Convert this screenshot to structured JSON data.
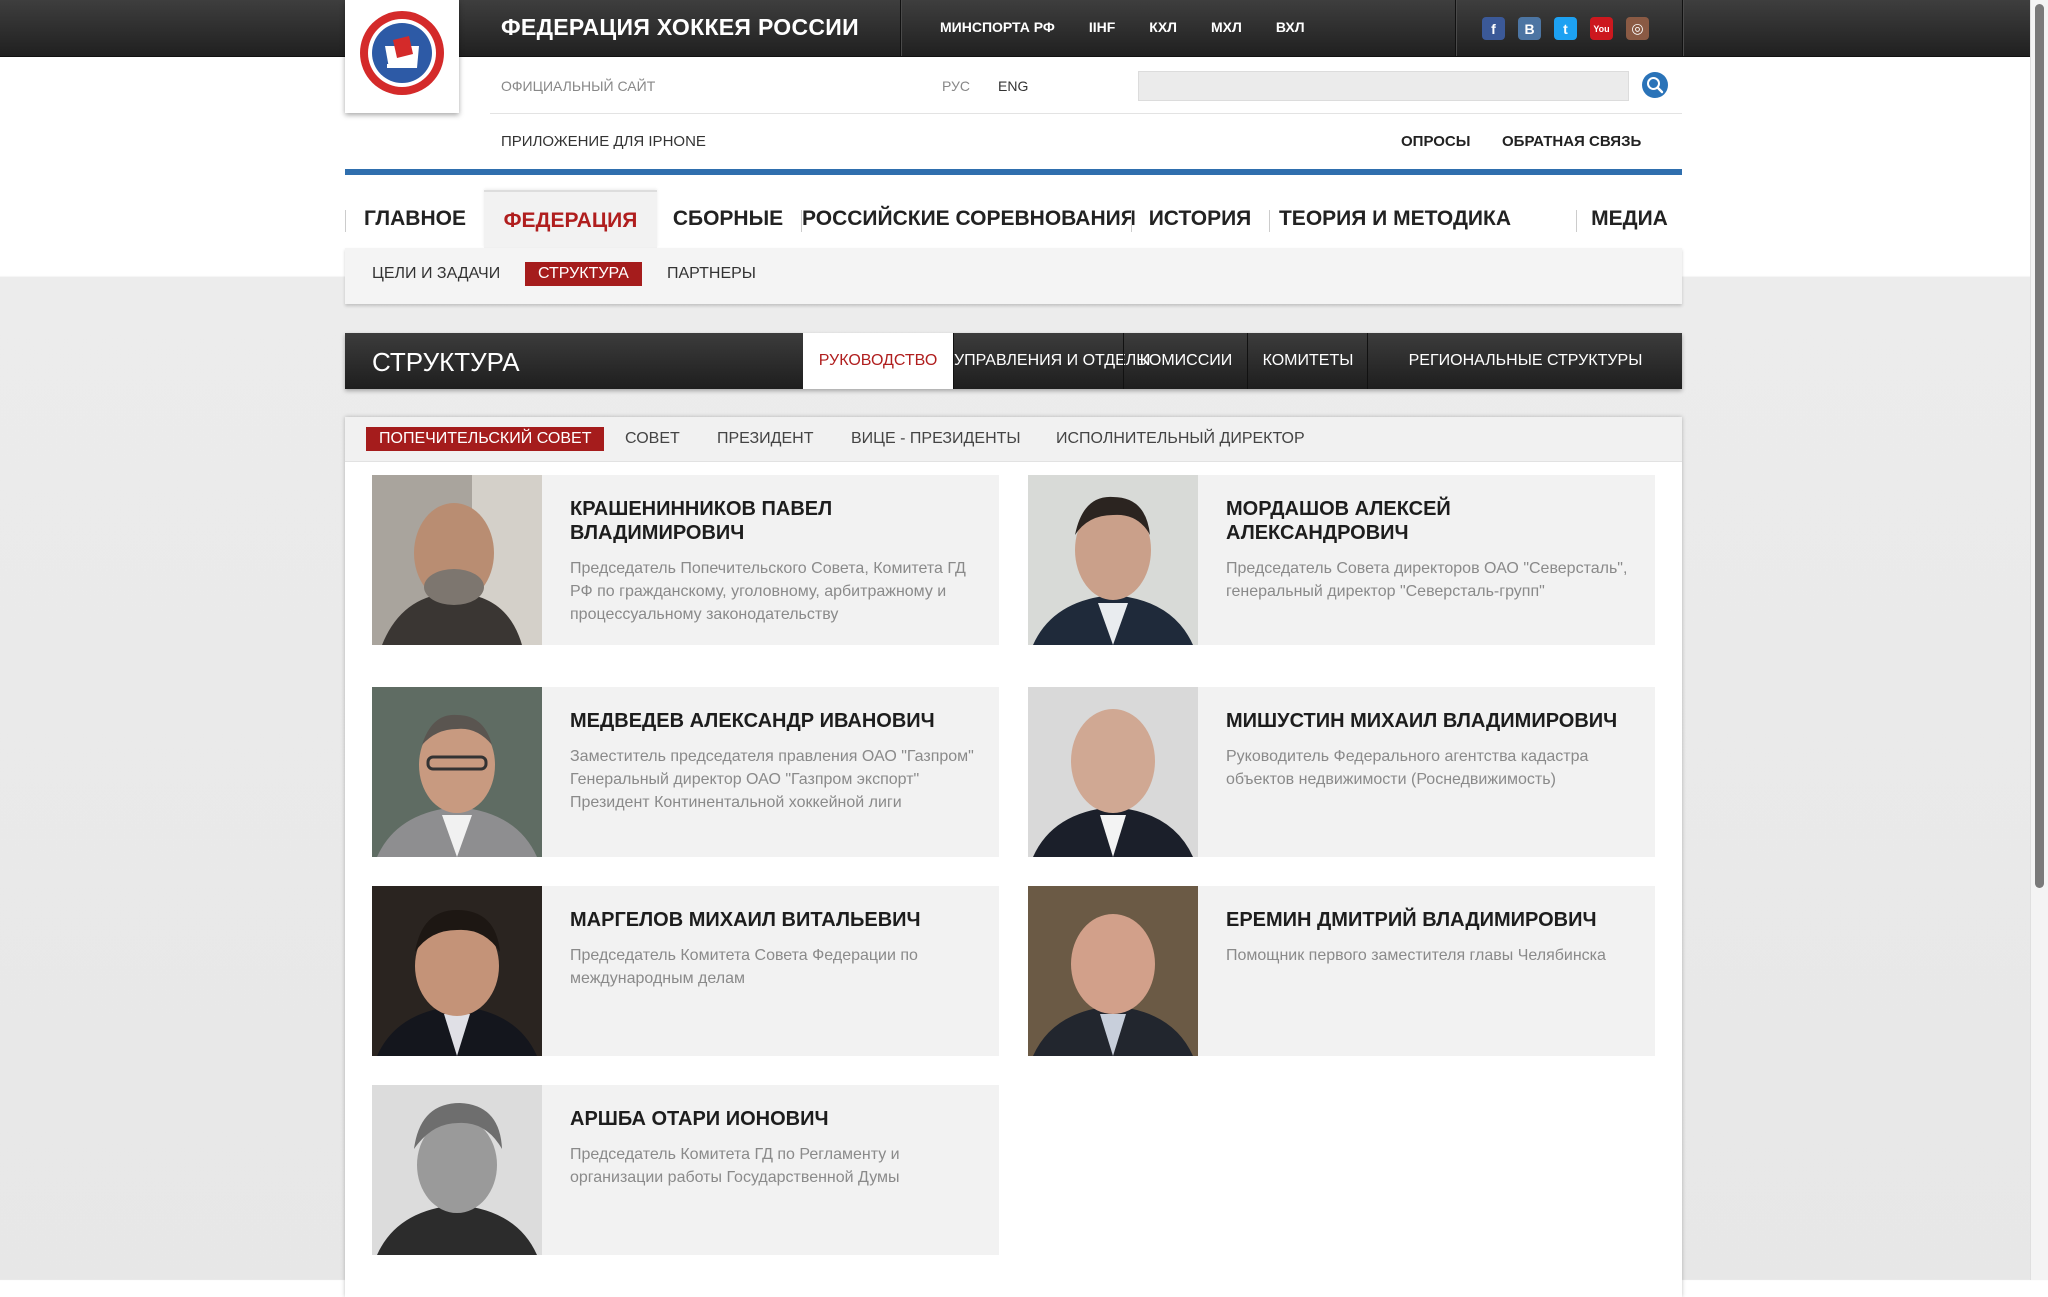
{
  "header": {
    "site_title": "ФЕДЕРАЦИЯ ХОККЕЯ РОССИИ",
    "logo_text": "ФЕДЕРАЦИЯ ХОККЕЯ РОССИИ",
    "top_links": [
      "МИНСПОРТА РФ",
      "IIHF",
      "КХЛ",
      "МХЛ",
      "ВХЛ"
    ],
    "social_icons": [
      "facebook-icon",
      "vkontakte-icon",
      "twitter-icon",
      "youtube-icon",
      "instagram-icon"
    ],
    "social_glyphs": [
      "f",
      "B",
      "t",
      "You",
      "◎"
    ],
    "social_colors": [
      "#3b5998",
      "#4c75a3",
      "#1da1f2",
      "#cc181e",
      "#8a5a44"
    ],
    "official_site": "ОФИЦИАЛЬНЫЙ САЙТ",
    "lang_ru": "РУС",
    "lang_en": "ENG",
    "search_placeholder": "",
    "iphone_app": "ПРИЛОЖЕНИЕ ДЛЯ IPHONE",
    "polls": "ОПРОСЫ",
    "feedback": "ОБРАТНАЯ СВЯЗЬ"
  },
  "main_nav": {
    "items": [
      "ГЛАВНОЕ",
      "ФЕДЕРАЦИЯ",
      "СБОРНЫЕ",
      "РОССИЙСКИЕ СОРЕВНОВАНИЯ",
      "ИСТОРИЯ",
      "ТЕОРИЯ И МЕТОДИКА",
      "МЕДИА"
    ],
    "active": "ФЕДЕРАЦИЯ"
  },
  "sub_nav": {
    "items": [
      "ЦЕЛИ И ЗАДАЧИ",
      "СТРУКТУРА",
      "ПАРТНЕРЫ"
    ],
    "active": "СТРУКТУРА"
  },
  "section": {
    "title": "СТРУКТУРА",
    "tabs": [
      "РУКОВОДСТВО",
      "УПРАВЛЕНИЯ И ОТДЕЛЫ",
      "КОМИССИИ",
      "КОМИТЕТЫ",
      "РЕГИОНАЛЬНЫЕ СТРУКТУРЫ"
    ],
    "active_tab": "РУКОВОДСТВО"
  },
  "panel_tabs": {
    "items": [
      "ПОПЕЧИТЕЛЬСКИЙ СОВЕТ",
      "СОВЕТ",
      "ПРЕЗИДЕНТ",
      "ВИЦЕ - ПРЕЗИДЕНТЫ",
      "ИСПОЛНИТЕЛЬНЫЙ ДИРЕКТОР"
    ],
    "active": "ПОПЕЧИТЕЛЬСКИЙ СОВЕТ"
  },
  "members": [
    {
      "name": "КРАШЕНИННИКОВ ПАВЕЛ ВЛАДИМИРОВИЧ",
      "description": "Председатель Попечительского Совета, Комитета ГД РФ по гражданскому, уголовному, арбитражному  и процессуальному законодательству"
    },
    {
      "name": "МОРДАШОВ АЛЕКСЕЙ АЛЕКСАНДРОВИЧ",
      "description": "Председатель Совета директоров ОАО \"Северсталь\", генеральный директор \"Северсталь-групп\""
    },
    {
      "name": "МЕДВЕДЕВ АЛЕКСАНДР ИВАНОВИЧ",
      "description": "Заместитель председателя правления ОАО \"Газпром\"\nГенеральный директор ОАО \"Газпром экспорт\"\nПрезидент Континентальной хоккейной лиги"
    },
    {
      "name": "МИШУСТИН МИХАИЛ ВЛАДИМИРОВИЧ",
      "description": "Руководитель Федерального агентства кадастра объектов недвижимости  (Роснедвижимость)"
    },
    {
      "name": "МАРГЕЛОВ МИХАИЛ ВИТАЛЬЕВИЧ",
      "description": "Председатель Комитета Совета Федерации по международным делам"
    },
    {
      "name": "ЕРЕМИН ДМИТРИЙ ВЛАДИМИРОВИЧ",
      "description": "Помощник первого заместителя главы Челябинска"
    },
    {
      "name": "АРШБА ОТАРИ ИОНОВИЧ",
      "description": "Председатель Комитета ГД по Регламенту и организации работы Государственной Думы"
    }
  ]
}
